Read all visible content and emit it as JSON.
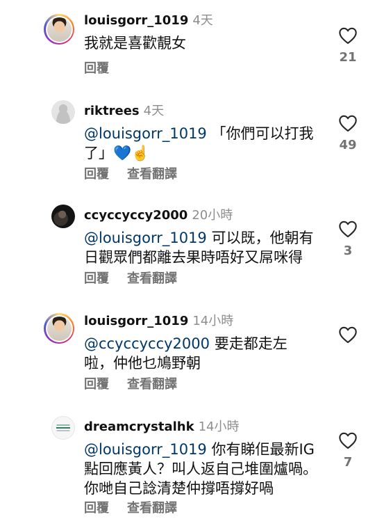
{
  "comments": [
    {
      "username": "louisgorr_1019",
      "time": "4天",
      "mention": "",
      "text": "我就是喜歡靚女",
      "reply_label": "回覆",
      "translate_label": "",
      "likes": "21",
      "avatar": "story-ring"
    },
    {
      "username": "riktrees",
      "time": "4天",
      "mention": "@louisgorr_1019",
      "text": "「你們可以打我了」💙☝️",
      "reply_label": "回覆",
      "translate_label": "查看翻譯",
      "likes": "49",
      "avatar": "default-silhouette"
    },
    {
      "username": "ccyccyccy2000",
      "time": "20小時",
      "mention": "@louisgorr_1019",
      "text": "可以既，他朝有日觀眾們都離去果時唔好又屌咪得",
      "reply_label": "回覆",
      "translate_label": "查看翻譯",
      "likes": "3",
      "avatar": "dark-photo"
    },
    {
      "username": "louisgorr_1019",
      "time": "14小時",
      "mention": "@ccyccyccy2000",
      "text": "要走都走左啦，仲他乜鳩野朝",
      "reply_label": "回覆",
      "translate_label": "查看翻譯",
      "likes": "",
      "avatar": "story-ring"
    },
    {
      "username": "dreamcrystalhk",
      "time": "14小時",
      "mention": "@louisgorr_1019",
      "text": "你有睇佢最新IG點回應黃人？叫人返自己堆圍爐喎。你哋自己諗清楚仲撐唔撐好喎",
      "reply_label": "回覆",
      "translate_label": "查看翻譯",
      "likes": "7",
      "avatar": "brand-logo"
    }
  ],
  "icons": {
    "like": "heart-outline-icon"
  }
}
